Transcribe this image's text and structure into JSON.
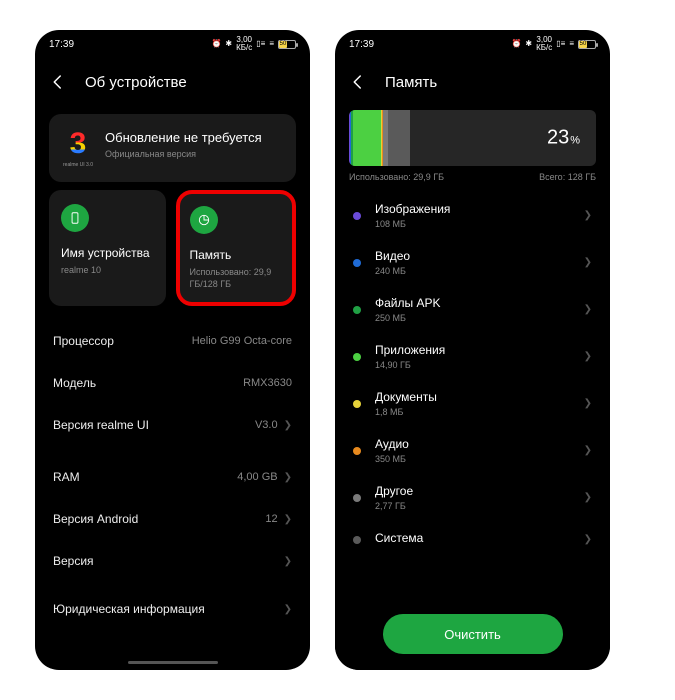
{
  "status": {
    "time": "17:39",
    "net_speed_top": "3,00",
    "net_speed_unit": "КБ/с",
    "battery_pct": "50"
  },
  "phone1": {
    "header_title": "Об устройстве",
    "update": {
      "logo_num": "3",
      "logo_caption": "realme UI 3.0",
      "line1": "Обновление не требуется",
      "line2": "Официальная версия"
    },
    "tile_device": {
      "title": "Имя устройства",
      "sub": "realme 10"
    },
    "tile_storage": {
      "title": "Память",
      "sub": "Использовано: 29,9 ГБ/128 ГБ"
    },
    "rows": {
      "cpu_label": "Процессор",
      "cpu_value": "Helio G99 Octa-core",
      "model_label": "Модель",
      "model_value": "RMX3630",
      "realmeui_label": "Версия realme UI",
      "realmeui_value": "V3.0",
      "ram_label": "RAM",
      "ram_value": "4,00 GB",
      "android_label": "Версия Android",
      "android_value": "12",
      "version_label": "Версия",
      "legal_label": "Юридическая информация"
    }
  },
  "phone2": {
    "header_title": "Память",
    "usage_pct": "23",
    "pct_unit": "%",
    "used_label": "Использовано: 29,9 ГБ",
    "total_label": "Всего: 128 ГБ",
    "categories": [
      {
        "color": "#6a4bd8",
        "title": "Изображения",
        "sub": "108 МБ"
      },
      {
        "color": "#1f6bd6",
        "title": "Видео",
        "sub": "240 МБ"
      },
      {
        "color": "#20a044",
        "title": "Файлы APK",
        "sub": "250 МБ"
      },
      {
        "color": "#4cd042",
        "title": "Приложения",
        "sub": "14,90  ГБ"
      },
      {
        "color": "#e6d23a",
        "title": "Документы",
        "sub": "1,8 МБ"
      },
      {
        "color": "#e88a1e",
        "title": "Аудио",
        "sub": "350 МБ"
      },
      {
        "color": "#7a7a7a",
        "title": "Другое",
        "sub": "2,77 ГБ"
      },
      {
        "color": "#5a5a5a",
        "title": "Система",
        "sub": ""
      }
    ],
    "clean_label": "Очистить"
  },
  "chart_data": {
    "type": "bar",
    "title": "Storage usage",
    "total_gb": 128,
    "used_gb": 29.9,
    "used_pct": 23,
    "segments": [
      {
        "name": "Изображения",
        "value_mb": 108,
        "color": "#6a4bd8"
      },
      {
        "name": "Видео",
        "value_mb": 240,
        "color": "#1f6bd6"
      },
      {
        "name": "Файлы APK",
        "value_mb": 250,
        "color": "#20a044"
      },
      {
        "name": "Приложения",
        "value_mb": 14900,
        "color": "#4cd042"
      },
      {
        "name": "Документы",
        "value_mb": 1.8,
        "color": "#e6d23a"
      },
      {
        "name": "Аудио",
        "value_mb": 350,
        "color": "#e88a1e"
      },
      {
        "name": "Другое",
        "value_mb": 2770,
        "color": "#7a7a7a"
      },
      {
        "name": "Система",
        "value_mb": 11280,
        "color": "#5a5a5a"
      }
    ]
  }
}
